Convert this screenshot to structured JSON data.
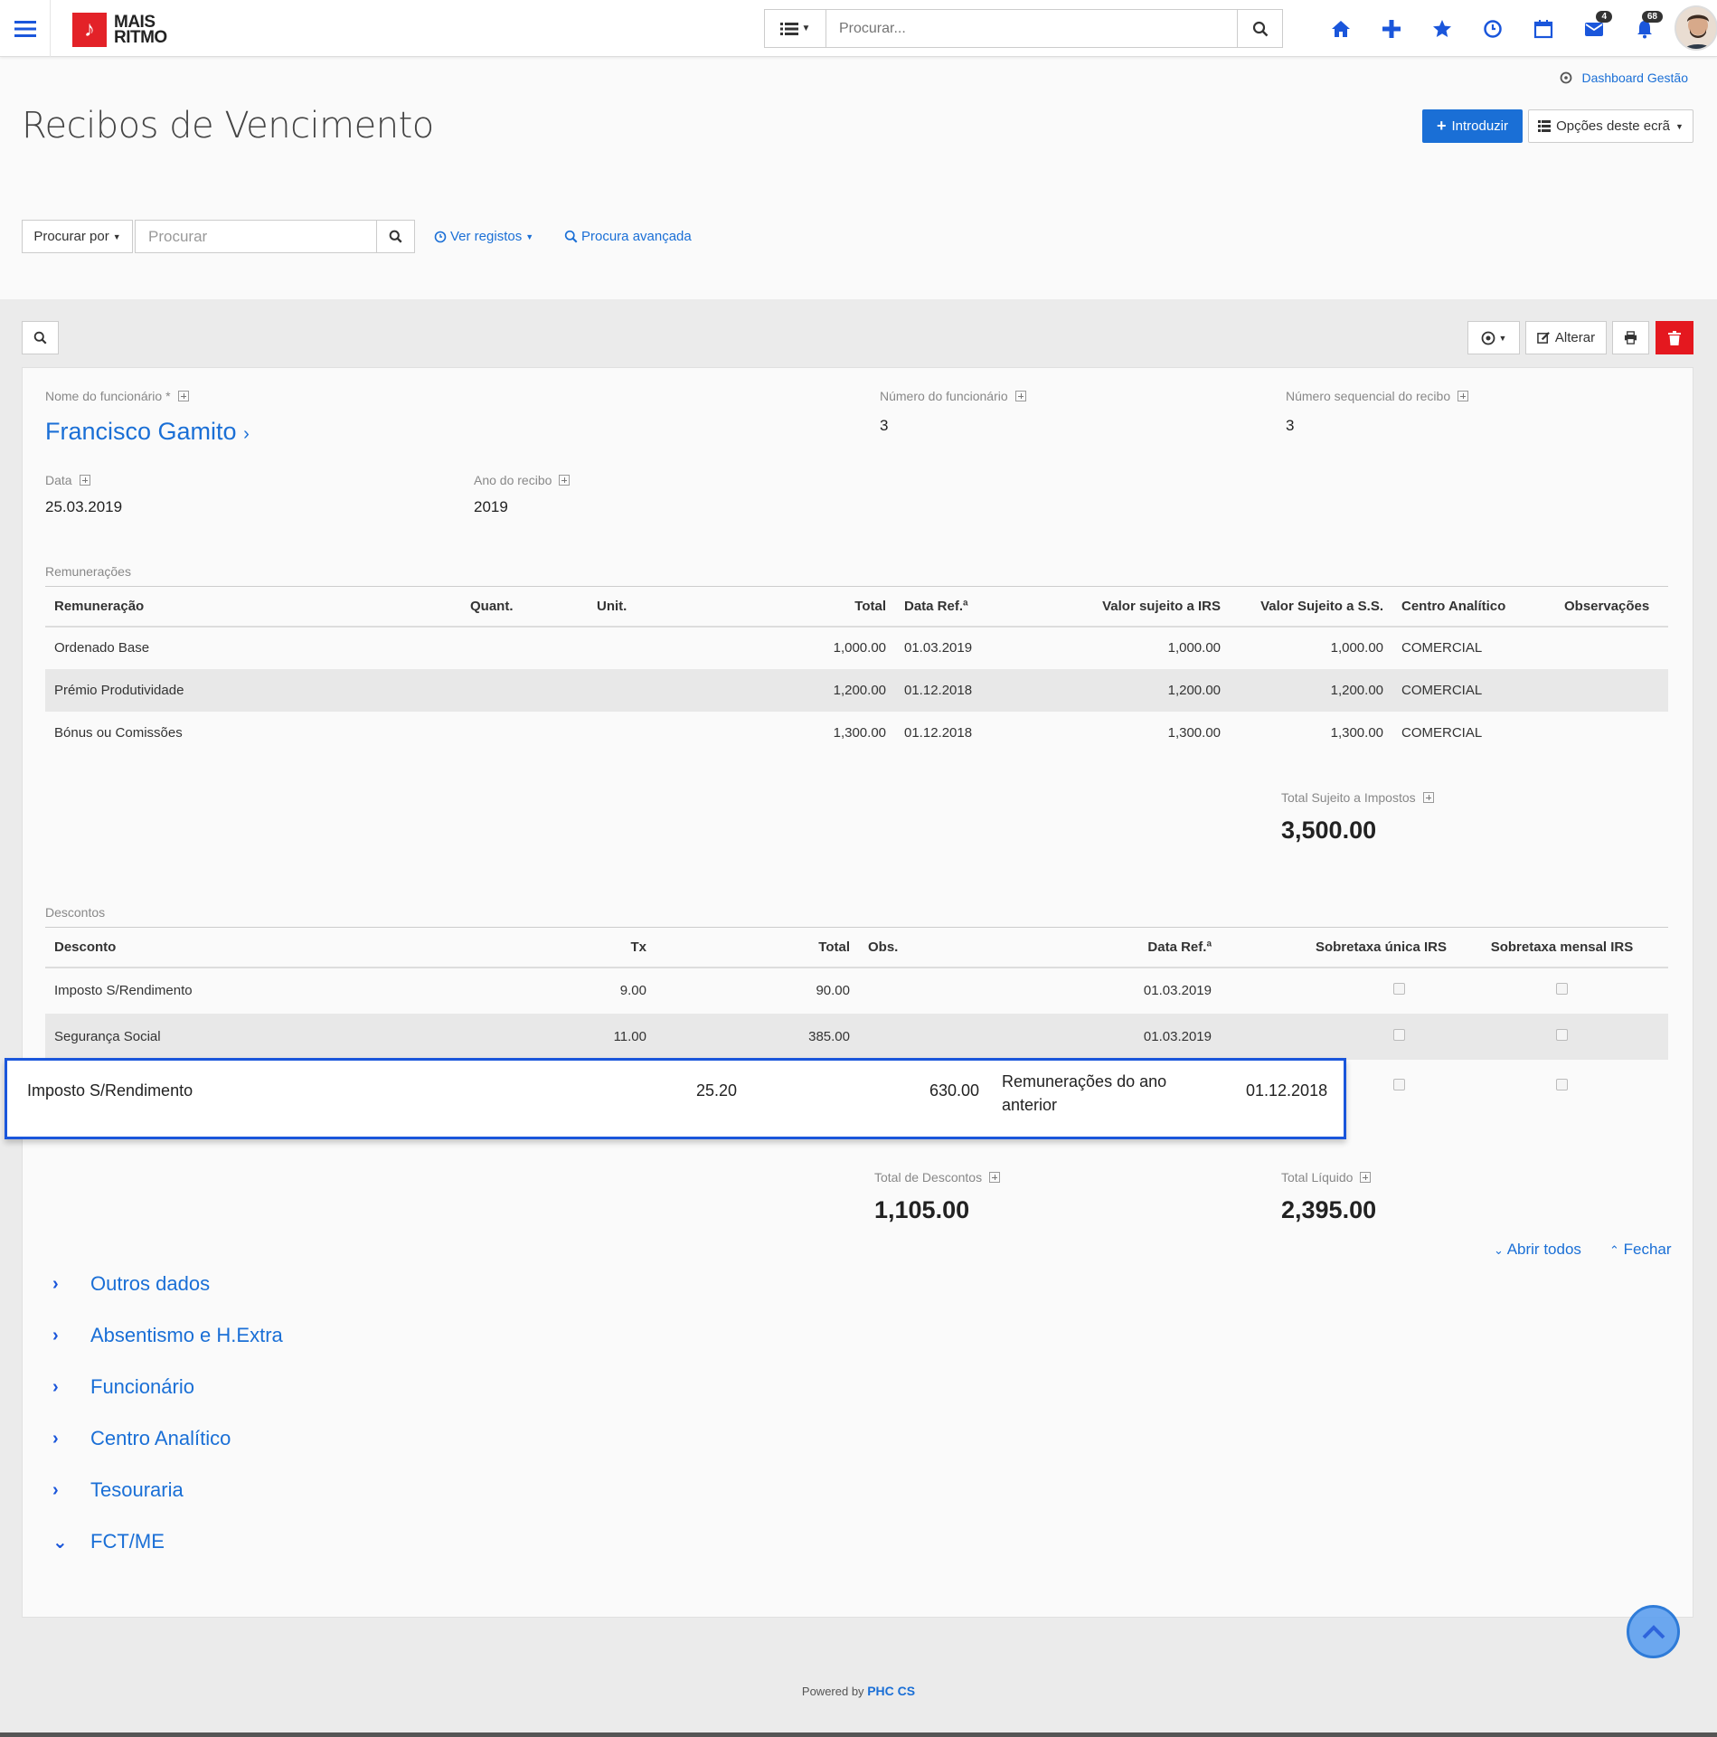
{
  "brand": {
    "line1": "MAIS",
    "line2": "RITMO"
  },
  "topbar": {
    "search_placeholder": "Procurar...",
    "mail_count": "4",
    "notif_count": "68"
  },
  "dashboard_link": "Dashboard Gestão",
  "page_title": "Recibos de Vencimento",
  "buttons": {
    "introduzir": "Introduzir",
    "opcoes": "Opções deste ecrã",
    "alterar": "Alterar"
  },
  "search": {
    "procurar_por": "Procurar por",
    "placeholder": "Procurar",
    "ver_registos": "Ver registos",
    "procura_avancada": "Procura avançada"
  },
  "record": {
    "nome_label": "Nome do funcionário *",
    "nome": "Francisco Gamito",
    "numero_label": "Número do funcionário",
    "numero": "3",
    "seq_label": "Número sequencial do recibo",
    "seq": "3",
    "data_label": "Data",
    "data": "25.03.2019",
    "ano_label": "Ano do recibo",
    "ano": "2019"
  },
  "remuneracoes": {
    "title": "Remunerações",
    "headers": [
      "Remuneração",
      "Quant.",
      "Unit.",
      "Total",
      "Data Ref.ª",
      "Valor sujeito a IRS",
      "Valor Sujeito a S.S.",
      "Centro Analítico",
      "Observações"
    ],
    "rows": [
      [
        "Ordenado Base",
        "",
        "",
        "1,000.00",
        "01.03.2019",
        "1,000.00",
        "1,000.00",
        "COMERCIAL",
        ""
      ],
      [
        "Prémio Produtividade",
        "",
        "",
        "1,200.00",
        "01.12.2018",
        "1,200.00",
        "1,200.00",
        "COMERCIAL",
        ""
      ],
      [
        "Bónus ou Comissões",
        "",
        "",
        "1,300.00",
        "01.12.2018",
        "1,300.00",
        "1,300.00",
        "COMERCIAL",
        ""
      ]
    ],
    "total_label": "Total Sujeito a Impostos",
    "total": "3,500.00"
  },
  "descontos": {
    "title": "Descontos",
    "headers": [
      "Desconto",
      "Tx",
      "Total",
      "Obs.",
      "Data Ref.ª",
      "Sobretaxa única IRS",
      "Sobretaxa mensal IRS"
    ],
    "rows": [
      [
        "Imposto S/Rendimento",
        "9.00",
        "90.00",
        "",
        "01.03.2019"
      ],
      [
        "Segurança Social",
        "11.00",
        "385.00",
        "",
        "01.03.2019"
      ]
    ],
    "highlight": {
      "desconto": "Imposto S/Rendimento",
      "tx": "25.20",
      "total": "630.00",
      "obs": "Remunerações do ano anterior",
      "data": "01.12.2018"
    },
    "total_descontos_label": "Total de Descontos",
    "total_descontos": "1,105.00",
    "total_liquido_label": "Total Líquido",
    "total_liquido": "2,395.00"
  },
  "accordion": {
    "abrir": "Abrir todos",
    "fechar": "Fechar",
    "items": [
      "Outros dados",
      "Absentismo e H.Extra",
      "Funcionário",
      "Centro Analítico",
      "Tesouraria",
      "FCT/ME"
    ]
  },
  "footer": {
    "powered": "Powered by",
    "brand": "PHC CS"
  }
}
